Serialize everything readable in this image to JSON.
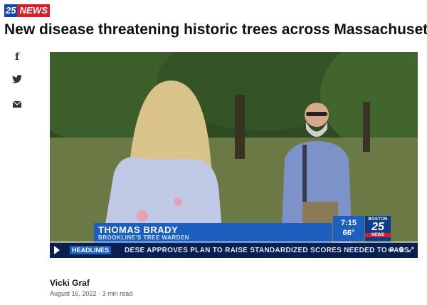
{
  "site": {
    "logo_number": "25",
    "logo_word": "NEWS"
  },
  "article": {
    "headline": "New disease threatening historic trees across Massachusetts",
    "author": "Vicki Graf",
    "date": "August 16, 2022",
    "read_time": "3 min read"
  },
  "share": {
    "icons": [
      "facebook-icon",
      "twitter-icon",
      "email-icon"
    ]
  },
  "video": {
    "lower_third": {
      "name": "THOMAS BRADY",
      "title": "BROOKLINE'S TREE WARDEN"
    },
    "clock": {
      "time": "7:15",
      "temp": "66°"
    },
    "station": {
      "city": "BOSTON",
      "number": "25",
      "word": "NEWS"
    },
    "ticker": {
      "tag": "HEADLINES",
      "text": "DESE APPROVES PLAN TO RAISE STANDARDIZED SCORES NEEDED TO PASS"
    },
    "progress": 0,
    "controls": [
      "play-icon",
      "closed-captions-icon",
      "settings-icon",
      "fullscreen-icon"
    ]
  },
  "colors": {
    "accent_blue": "#1c5fbf",
    "accent_red": "#d4202b",
    "ticker_bg": "#0a1f4f"
  }
}
